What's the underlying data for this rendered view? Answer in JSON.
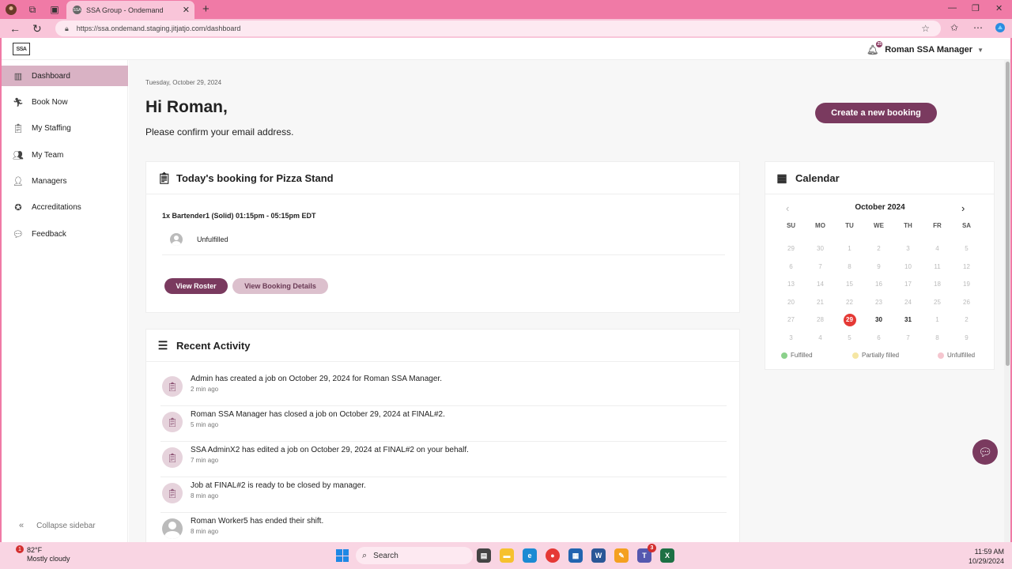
{
  "browser": {
    "tab_title": "SSA Group - Ondemand",
    "favicon_text": "SSA",
    "url": "https://ssa.ondemand.staging.jitjatjo.com/dashboard"
  },
  "header": {
    "logo_text": "SSA",
    "user_name": "Roman SSA Manager",
    "notif_badge": "25"
  },
  "sidebar": {
    "items": [
      {
        "label": "Dashboard",
        "icon": "chart-icon"
      },
      {
        "label": "Book Now",
        "icon": "runner-icon"
      },
      {
        "label": "My Staffing",
        "icon": "clipboard-icon"
      },
      {
        "label": "My Team",
        "icon": "team-icon"
      },
      {
        "label": "Managers",
        "icon": "manager-icon"
      },
      {
        "label": "Accreditations",
        "icon": "badge-icon"
      },
      {
        "label": "Feedback",
        "icon": "comment-icon"
      }
    ],
    "collapse_label": "Collapse sidebar"
  },
  "main": {
    "date": "Tuesday, October 29, 2024",
    "greeting": "Hi Roman,",
    "confirm_text": "Please confirm your email address.",
    "create_button": "Create a new booking"
  },
  "booking": {
    "title": "Today's booking for Pizza Stand",
    "line": "1x Bartender1 (Solid) 01:15pm - 05:15pm EDT",
    "status": "Unfulfilled",
    "roster_button": "View Roster",
    "details_button": "View Booking Details"
  },
  "activity": {
    "title": "Recent Activity",
    "items": [
      {
        "text": "Admin has created a job on October 29, 2024 for Roman SSA Manager.",
        "time": "2 min ago"
      },
      {
        "text": "Roman SSA Manager has closed a job on October 29, 2024 at FINAL#2.",
        "time": "5 min ago"
      },
      {
        "text": "SSA AdminX2 has edited a job on October 29, 2024 at FINAL#2 on your behalf.",
        "time": "7 min ago"
      },
      {
        "text": "Job at FINAL#2 is ready to be closed by manager.",
        "time": "8 min ago"
      },
      {
        "text": "Roman Worker5 has ended their shift.",
        "time": "8 min ago"
      }
    ]
  },
  "calendar": {
    "title": "Calendar",
    "month": "October 2024",
    "weekdays": [
      "SU",
      "MO",
      "TU",
      "WE",
      "TH",
      "FR",
      "SA"
    ],
    "weeks": [
      [
        "29",
        "30",
        "1",
        "2",
        "3",
        "4",
        "5"
      ],
      [
        "6",
        "7",
        "8",
        "9",
        "10",
        "11",
        "12"
      ],
      [
        "13",
        "14",
        "15",
        "16",
        "17",
        "18",
        "19"
      ],
      [
        "20",
        "21",
        "22",
        "23",
        "24",
        "25",
        "26"
      ],
      [
        "27",
        "28",
        "29",
        "30",
        "31",
        "1",
        "2"
      ],
      [
        "3",
        "4",
        "5",
        "6",
        "7",
        "8",
        "9"
      ]
    ],
    "today": "29",
    "legend": [
      {
        "label": "Fulfilled",
        "color": "#8bd18b"
      },
      {
        "label": "Partially filled",
        "color": "#f5e6a3"
      },
      {
        "label": "Unfulfilled",
        "color": "#f5c6cf"
      }
    ]
  },
  "taskbar": {
    "weather_temp": "82°F",
    "weather_desc": "Mostly cloudy",
    "weather_badge": "1",
    "search_label": "Search",
    "time": "11:59 AM",
    "date": "10/29/2024",
    "teams_badge": "3"
  },
  "colors": {
    "accent": "#7a3a5f",
    "browser_frame": "#f07aa6",
    "today": "#e53935"
  }
}
